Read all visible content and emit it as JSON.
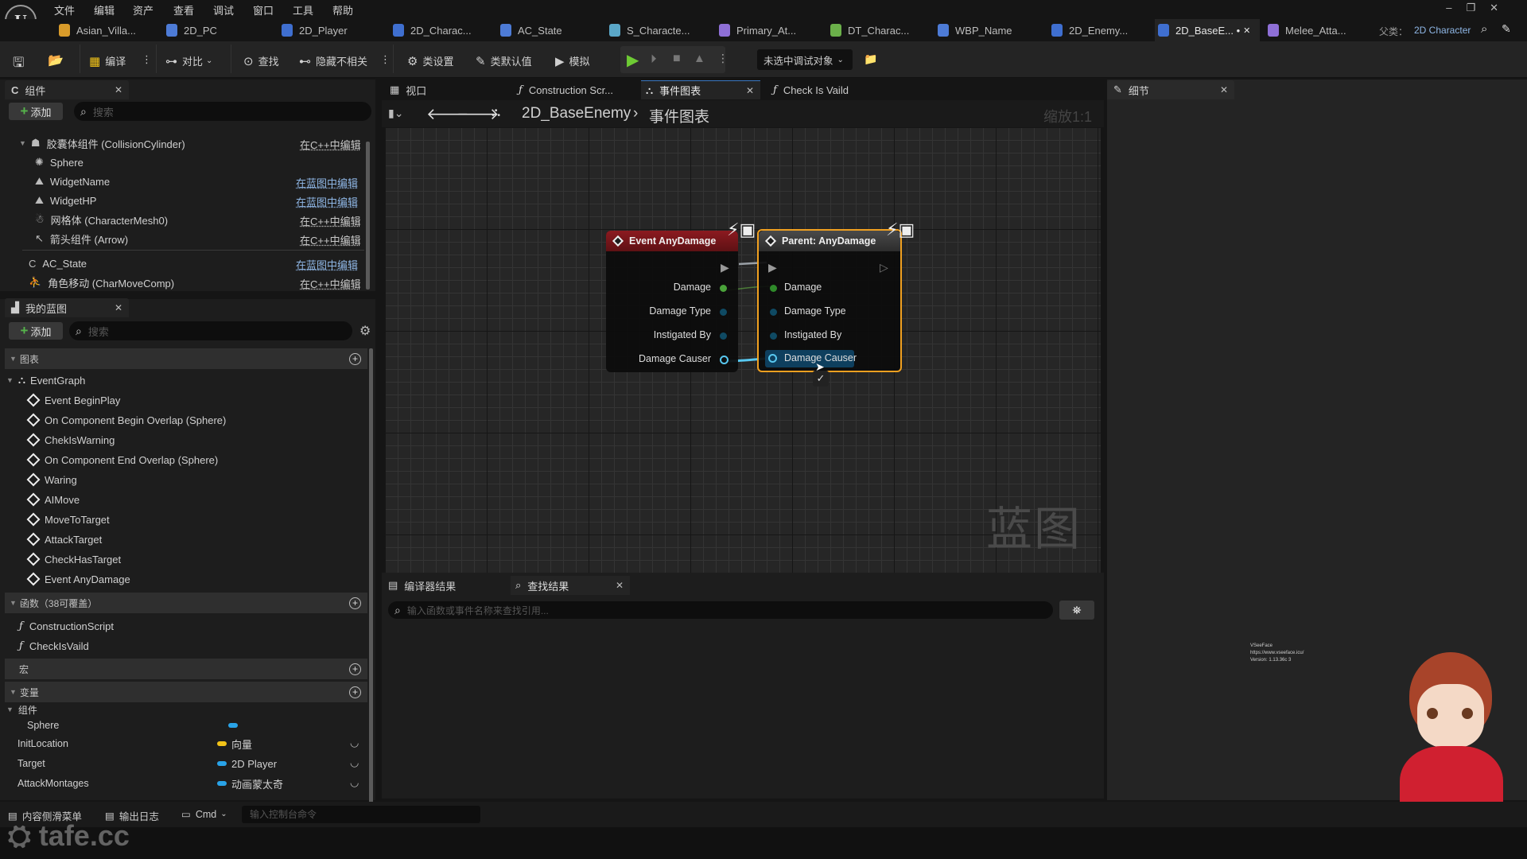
{
  "menu": [
    "文件",
    "编辑",
    "资产",
    "查看",
    "调试",
    "窗口",
    "工具",
    "帮助"
  ],
  "doc_tabs": [
    {
      "label": "Asian_Villa...",
      "color": "#d89b2a"
    },
    {
      "label": "2D_PC",
      "color": "#4d7bd6"
    },
    {
      "label": "2D_Player",
      "color": "#3f6fd0"
    },
    {
      "label": "2D_Charac...",
      "color": "#3f6fd0"
    },
    {
      "label": "AC_State",
      "color": "#4d7bd6"
    },
    {
      "label": "S_Characte...",
      "color": "#5aa7c8"
    },
    {
      "label": "Primary_At...",
      "color": "#8e6fd6"
    },
    {
      "label": "DT_Charac...",
      "color": "#6bb04a"
    },
    {
      "label": "WBP_Name",
      "color": "#4d7bd6"
    },
    {
      "label": "2D_Enemy...",
      "color": "#3f6fd0"
    },
    {
      "label": "2D_BaseE... •",
      "color": "#3f6fd0",
      "active": true
    },
    {
      "label": "Melee_Atta...",
      "color": "#8e6fd6"
    }
  ],
  "parent_class": {
    "label": "父类：",
    "value": "2D Character"
  },
  "toolbar": {
    "compile": "编译",
    "diff": "对比",
    "find": "查找",
    "hide_unrelated": "隐藏不相关",
    "class_settings": "类设置",
    "class_defaults": "类默认值",
    "simulate": "模拟",
    "debug_target": "未选中调试对象"
  },
  "components_panel": {
    "title": "组件",
    "add": "添加",
    "search_placeholder": "搜索",
    "items": [
      {
        "label": "胶囊体组件 (CollisionCylinder)",
        "action": "在C++中编辑",
        "blue": false
      },
      {
        "label": "Sphere",
        "action": "",
        "blue": false
      },
      {
        "label": "WidgetName",
        "action": "在蓝图中编辑",
        "blue": true
      },
      {
        "label": "WidgetHP",
        "action": "在蓝图中编辑",
        "blue": true
      },
      {
        "label": "网格体 (CharacterMesh0)",
        "action": "在C++中编辑",
        "blue": false
      },
      {
        "label": "箭头组件 (Arrow)",
        "action": "在C++中编辑",
        "blue": false
      },
      {
        "label": "AC_State",
        "action": "在蓝图中编辑",
        "blue": true
      },
      {
        "label": "角色移动 (CharMoveComp)",
        "action": "在C++中编辑",
        "blue": false
      }
    ]
  },
  "my_blueprint": {
    "title": "我的蓝图",
    "add": "添加",
    "search_placeholder": "搜索",
    "graphs_section": "图表",
    "event_graph": "EventGraph",
    "events": [
      "Event BeginPlay",
      "On Component Begin Overlap (Sphere)",
      "ChekIsWarning",
      "On Component End Overlap (Sphere)",
      "Waring",
      "AIMove",
      "MoveToTarget",
      "AttackTarget",
      "CheckHasTarget",
      "Event AnyDamage"
    ],
    "functions_section": "函数（38可覆盖）",
    "functions": [
      "ConstructionScript",
      "CheckIsVaild"
    ],
    "macros_section": "宏",
    "variables_section": "变量",
    "components_group": "组件",
    "variables": [
      {
        "name": "Sphere",
        "type": "",
        "color": "#29a3e8"
      },
      {
        "name": "InitLocation",
        "type": "向量",
        "color": "#f2c318"
      },
      {
        "name": "Target",
        "type": "2D Player",
        "color": "#29a3e8"
      },
      {
        "name": "AttackMontages",
        "type": "动画蒙太奇",
        "color": "#29a3e8"
      }
    ]
  },
  "editor_tabs": [
    {
      "label": "视口"
    },
    {
      "label": "Construction Scr..."
    },
    {
      "label": "事件图表",
      "active": true
    },
    {
      "label": "Check Is Vaild"
    }
  ],
  "breadcrumb": {
    "blueprint": "2D_BaseEnemy",
    "graph": "事件图表",
    "zoom": "缩放1:1"
  },
  "nodes": {
    "event": {
      "title": "Event AnyDamage",
      "pins": [
        "Damage",
        "Damage Type",
        "Instigated By",
        "Damage Causer"
      ]
    },
    "parent": {
      "title": "Parent: AnyDamage",
      "pins": [
        "Damage",
        "Damage Type",
        "Instigated By",
        "Damage Causer"
      ]
    }
  },
  "watermark": "蓝图",
  "details_panel": {
    "title": "细节"
  },
  "bottom_tabs": {
    "compiler": "编译器结果",
    "find": "查找结果",
    "find_placeholder": "输入函数或事件名称来查找引用..."
  },
  "status_bar": {
    "content_drawer": "内容侧滑菜单",
    "output_log": "输出日志",
    "cmd": "Cmd",
    "console_placeholder": "输入控制台命令"
  },
  "overlay": {
    "vseeface": "VSeeFace",
    "url": "https://www.vseeface.icu/",
    "version": "Version: 1.13.36c 3"
  }
}
